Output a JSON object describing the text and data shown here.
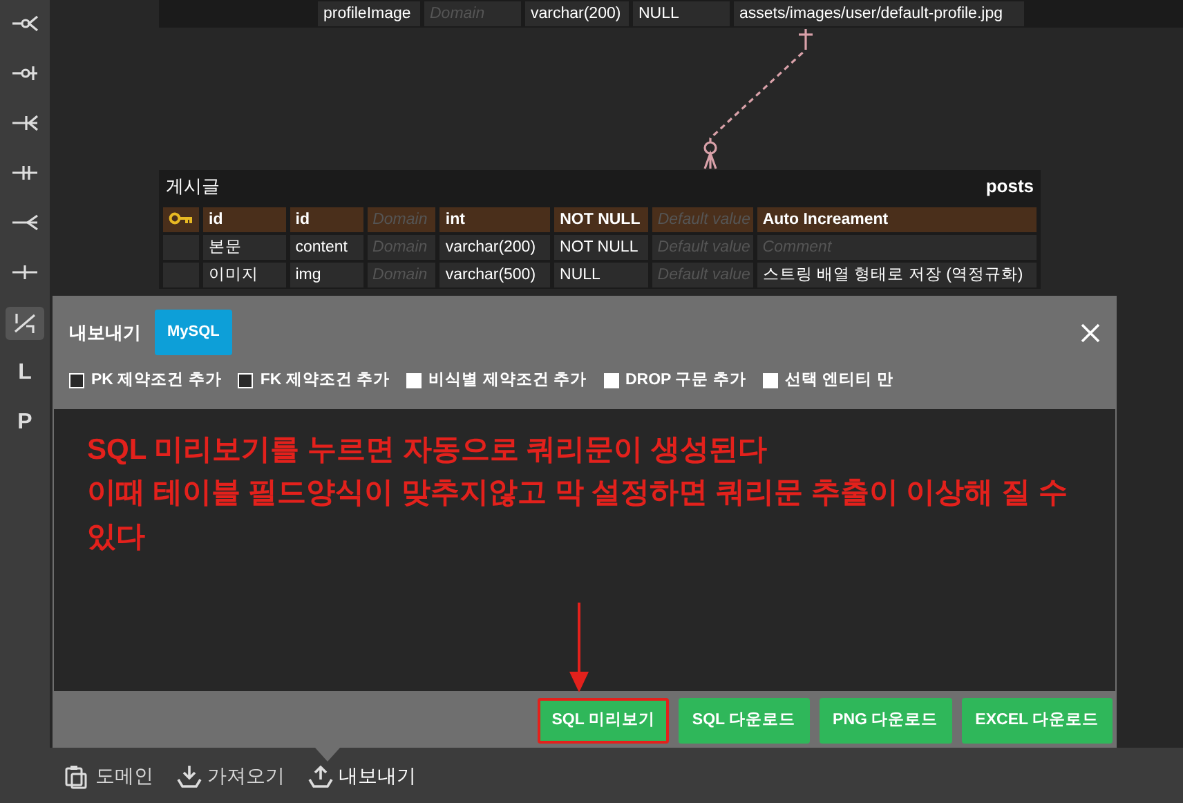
{
  "sidebar": {
    "tools": [
      {
        "selected": false
      },
      {
        "selected": false
      },
      {
        "selected": false
      },
      {
        "selected": false
      },
      {
        "selected": false
      },
      {
        "selected": false
      },
      {
        "selected": true
      },
      {
        "label": "L",
        "selected": false
      },
      {
        "label": "P",
        "selected": false
      }
    ]
  },
  "upper_table": {
    "cells": [
      {
        "text": "profileImage"
      },
      {
        "placeholder": "Domain"
      },
      {
        "text": "varchar(200)"
      },
      {
        "text": "NULL"
      },
      {
        "text": "assets/images/user/default-profile.jpg"
      }
    ]
  },
  "posts_table": {
    "title": "게시글",
    "name": "posts",
    "rows": [
      {
        "primary_key": true,
        "cells": [
          {
            "text": "id"
          },
          {
            "text": "id"
          },
          {
            "placeholder": "Domain"
          },
          {
            "text": "int"
          },
          {
            "text": "NOT NULL"
          },
          {
            "placeholder": "Default value"
          },
          {
            "text": "Auto Increament"
          }
        ]
      },
      {
        "primary_key": false,
        "cells": [
          {
            "text": "본문"
          },
          {
            "text": "content"
          },
          {
            "placeholder": "Domain"
          },
          {
            "text": "varchar(200)"
          },
          {
            "text": "NOT NULL"
          },
          {
            "placeholder": "Default value"
          },
          {
            "placeholder": "Comment"
          }
        ]
      },
      {
        "primary_key": false,
        "cells": [
          {
            "text": "이미지"
          },
          {
            "text": "img"
          },
          {
            "placeholder": "Domain"
          },
          {
            "text": "varchar(500)"
          },
          {
            "text": "NULL"
          },
          {
            "placeholder": "Default value"
          },
          {
            "text": "스트링 배열 형태로 저장 (역정규화)"
          }
        ]
      }
    ]
  },
  "export_dialog": {
    "title": "내보내기",
    "dialects": [
      {
        "label": "MySQL",
        "selected": true
      }
    ],
    "options": [
      {
        "label": "PK 제약조건 추가",
        "checked": true
      },
      {
        "label": "FK 제약조건 추가",
        "checked": true
      },
      {
        "label": "비식별 제약조건 추가",
        "checked": false
      },
      {
        "label": "DROP 구문 추가",
        "checked": false
      },
      {
        "label": "선택 엔티티 만",
        "checked": false
      }
    ],
    "annotation": {
      "lines": [
        "SQL 미리보기를 누르면 자동으로 쿼리문이 생성된다",
        "이때 테이블 필드양식이 맞추지않고 막 설정하면 쿼리문 추출이 이상해 질 수 있다"
      ]
    },
    "buttons": [
      {
        "label": "SQL 미리보기",
        "highlighted": true
      },
      {
        "label": "SQL 다운로드",
        "highlighted": false
      },
      {
        "label": "PNG 다운로드",
        "highlighted": false
      },
      {
        "label": "EXCEL 다운로드",
        "highlighted": false
      }
    ]
  },
  "bottom_bar": {
    "items": [
      {
        "label": "도메인",
        "selected": false
      },
      {
        "label": "가져오기",
        "selected": false
      },
      {
        "label": "내보내기",
        "selected": true
      }
    ]
  }
}
